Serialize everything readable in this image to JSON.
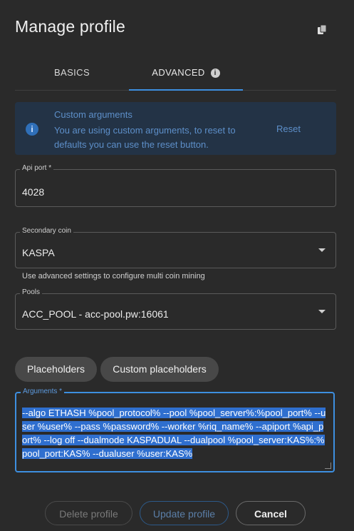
{
  "dialog": {
    "title": "Manage profile"
  },
  "tabs": [
    {
      "label": "BASICS"
    },
    {
      "label": "ADVANCED"
    }
  ],
  "alert": {
    "title": "Custom arguments",
    "text": "You are using custom arguments, to reset to defaults you can use the reset button.",
    "reset_label": "Reset"
  },
  "fields": {
    "api_port": {
      "label": "Api port *",
      "value": "4028"
    },
    "secondary_coin": {
      "label": "Secondary coin",
      "value": "KASPA",
      "helper": "Use advanced settings to configure multi coin mining"
    },
    "pools": {
      "label": "Pools",
      "value": "ACC_POOL - acc-pool.pw:16061"
    },
    "arguments": {
      "label": "Arguments *",
      "value": "--algo ETHASH %pool_protocol% --pool %pool_server%:%pool_port% --user %user% --pass %password% --worker %riq_name% --apiport %api_port% --log off --dualmode KASPADUAL --dualpool %pool_server:KAS%:%pool_port:KAS% --dualuser %user:KAS%"
    }
  },
  "chips": {
    "placeholders": "Placeholders",
    "custom_placeholders": "Custom placeholders"
  },
  "footer": {
    "delete": "Delete profile",
    "update": "Update profile",
    "cancel": "Cancel"
  },
  "colors": {
    "accent": "#3d8fe0",
    "alert_bg": "#233346",
    "background": "#2a2a2a"
  }
}
